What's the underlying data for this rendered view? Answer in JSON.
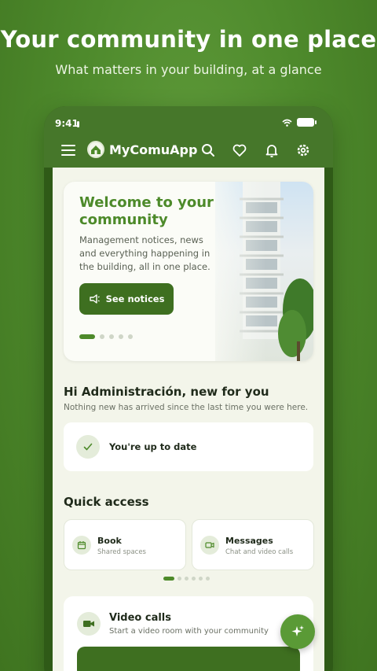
{
  "promo": {
    "title": "Your community in one place",
    "subtitle": "What matters in your building, at a glance"
  },
  "status_bar": {
    "time": "9:41"
  },
  "top_bar": {
    "app_name": "MyComuApp",
    "icons": [
      "menu-icon",
      "app-logo-icon",
      "search-icon",
      "heart-icon",
      "bell-icon",
      "gear-icon"
    ]
  },
  "hero": {
    "title": "Welcome to your community",
    "text": "Management notices, news and everything happening in the building, all in one place.",
    "button_label": "See notices",
    "button_icon": "megaphone-icon",
    "carousel": {
      "count": 5,
      "active": 0
    }
  },
  "greeting": {
    "title": "Hi Administración, new for you",
    "subtitle": "Nothing new has arrived since the last time you were here.",
    "status_label": "You're up to date",
    "status_icon": "check-icon"
  },
  "quick_access": {
    "title": "Quick access",
    "items": [
      {
        "label": "Book",
        "sub": "Shared spaces",
        "icon": "calendar-icon"
      },
      {
        "label": "Messages",
        "sub": "Chat and video calls",
        "icon": "video-camera-icon"
      }
    ],
    "carousel": {
      "count": 6,
      "active": 0
    }
  },
  "video_calls": {
    "title": "Video calls",
    "subtitle": "Start a video room with your community",
    "icon": "video-camera-icon"
  },
  "fab": {
    "icon": "sparkle-icon"
  },
  "colors": {
    "brand_green": "#46772a",
    "accent_green": "#4d8a2a",
    "button_green": "#3e6f20",
    "content_bg": "#f3f5ea"
  }
}
